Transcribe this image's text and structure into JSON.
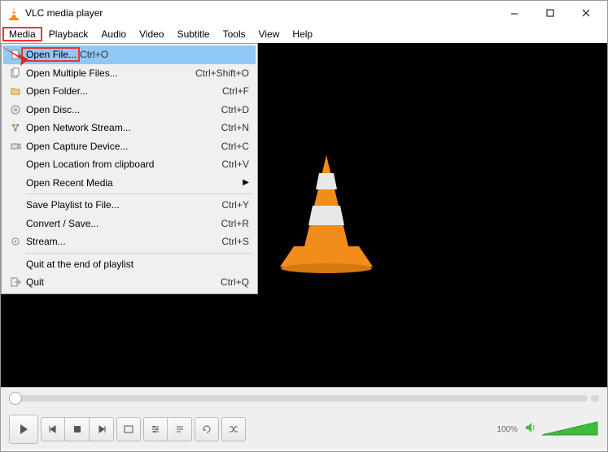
{
  "titlebar": {
    "title": "VLC media player"
  },
  "menubar": {
    "items": [
      "Media",
      "Playback",
      "Audio",
      "Video",
      "Subtitle",
      "Tools",
      "View",
      "Help"
    ],
    "highlighted_index": 0
  },
  "media_menu": {
    "highlighted_index": 0,
    "groups": [
      [
        {
          "icon": "file-icon",
          "label": "Open File...",
          "shortcut": "Ctrl+O"
        },
        {
          "icon": "files-icon",
          "label": "Open Multiple Files...",
          "shortcut": "Ctrl+Shift+O"
        },
        {
          "icon": "folder-icon",
          "label": "Open Folder...",
          "shortcut": "Ctrl+F"
        },
        {
          "icon": "disc-icon",
          "label": "Open Disc...",
          "shortcut": "Ctrl+D"
        },
        {
          "icon": "network-icon",
          "label": "Open Network Stream...",
          "shortcut": "Ctrl+N"
        },
        {
          "icon": "capture-icon",
          "label": "Open Capture Device...",
          "shortcut": "Ctrl+C"
        },
        {
          "icon": null,
          "label": "Open Location from clipboard",
          "shortcut": "Ctrl+V"
        },
        {
          "icon": null,
          "label": "Open Recent Media",
          "shortcut": null,
          "submenu": true
        }
      ],
      [
        {
          "icon": null,
          "label": "Save Playlist to File...",
          "shortcut": "Ctrl+Y"
        },
        {
          "icon": null,
          "label": "Convert / Save...",
          "shortcut": "Ctrl+R"
        },
        {
          "icon": "stream-icon",
          "label": "Stream...",
          "shortcut": "Ctrl+S"
        }
      ],
      [
        {
          "icon": null,
          "label": "Quit at the end of playlist",
          "shortcut": null
        },
        {
          "icon": "quit-icon",
          "label": "Quit",
          "shortcut": "Ctrl+Q"
        }
      ]
    ]
  },
  "controls": {
    "volume_label": "100%"
  },
  "colors": {
    "highlight_border": "#e33",
    "menu_highlight": "#90c8f6",
    "cone_orange": "#f28c1a"
  }
}
